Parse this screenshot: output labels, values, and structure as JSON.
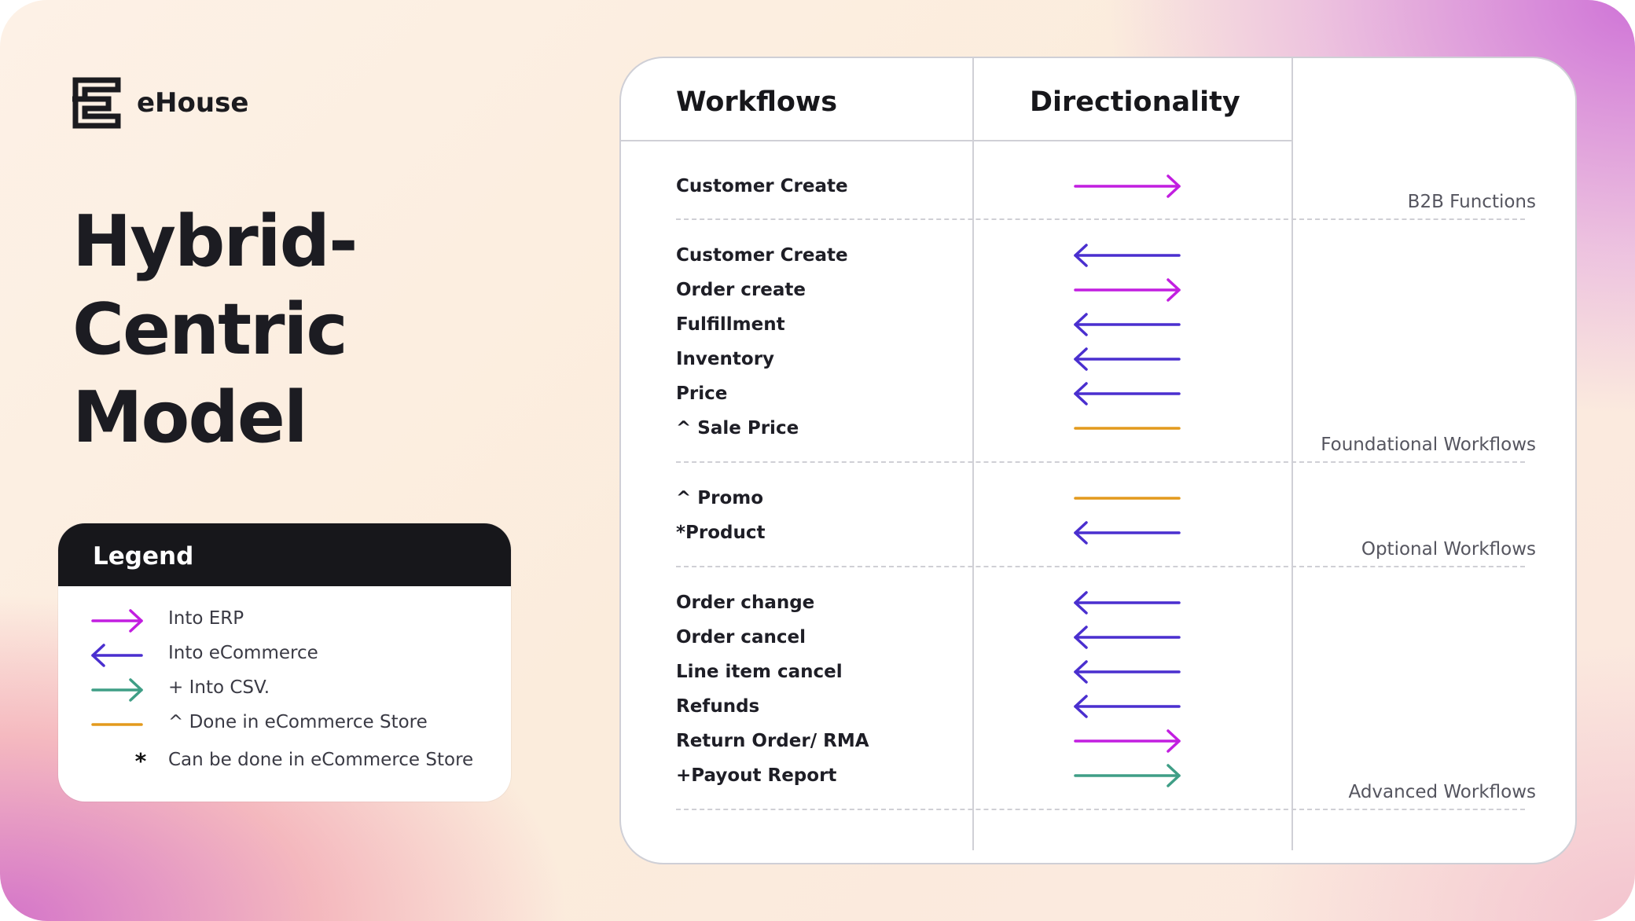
{
  "brand": {
    "name": "eHouse",
    "logo_icon": "ehouse-logo-icon"
  },
  "title": {
    "line1": "Hybrid-",
    "line2": "Centric",
    "line3": "Model"
  },
  "colors": {
    "into_erp": "#c21ee0",
    "into_ecommerce": "#4a2fcf",
    "into_csv": "#3f9e86",
    "done_in_store": "#e39a1d"
  },
  "legend": {
    "title": "Legend",
    "items": [
      {
        "type": "right",
        "color": "#c21ee0",
        "label": "Into ERP"
      },
      {
        "type": "left",
        "color": "#4a2fcf",
        "label": "Into eCommerce"
      },
      {
        "type": "right",
        "color": "#3f9e86",
        "label": "+ Into CSV."
      },
      {
        "type": "line",
        "color": "#e39a1d",
        "label": "^ Done in eCommerce Store"
      },
      {
        "type": "star",
        "symbol": "*",
        "label": "Can be done in eCommerce Store"
      }
    ]
  },
  "table": {
    "headers": {
      "workflows": "Workflows",
      "directionality": "Directionality"
    },
    "groups": [
      {
        "label": "B2B Functions",
        "rows": [
          {
            "name": "Customer Create",
            "direction": "right",
            "color": "#c21ee0"
          }
        ]
      },
      {
        "label": "Foundational Workflows",
        "rows": [
          {
            "name": "Customer Create",
            "direction": "left",
            "color": "#4a2fcf"
          },
          {
            "name": "Order create",
            "direction": "right",
            "color": "#c21ee0"
          },
          {
            "name": "Fulfillment",
            "direction": "left",
            "color": "#4a2fcf"
          },
          {
            "name": "Inventory",
            "direction": "left",
            "color": "#4a2fcf"
          },
          {
            "name": "Price",
            "direction": "left",
            "color": "#4a2fcf"
          },
          {
            "name": "^ Sale Price",
            "direction": "line",
            "color": "#e39a1d"
          }
        ]
      },
      {
        "label": "Optional Workflows",
        "rows": [
          {
            "name": "^ Promo",
            "direction": "line",
            "color": "#e39a1d"
          },
          {
            "name": "*Product",
            "direction": "left",
            "color": "#4a2fcf"
          }
        ]
      },
      {
        "label": "Advanced Workflows",
        "rows": [
          {
            "name": "Order change",
            "direction": "left",
            "color": "#4a2fcf"
          },
          {
            "name": "Order cancel",
            "direction": "left",
            "color": "#4a2fcf"
          },
          {
            "name": "Line item cancel",
            "direction": "left",
            "color": "#4a2fcf"
          },
          {
            "name": "Refunds",
            "direction": "left",
            "color": "#4a2fcf"
          },
          {
            "name": "Return Order/ RMA",
            "direction": "right",
            "color": "#c21ee0"
          },
          {
            "name": "+Payout Report",
            "direction": "right",
            "color": "#3f9e86"
          }
        ]
      }
    ]
  }
}
